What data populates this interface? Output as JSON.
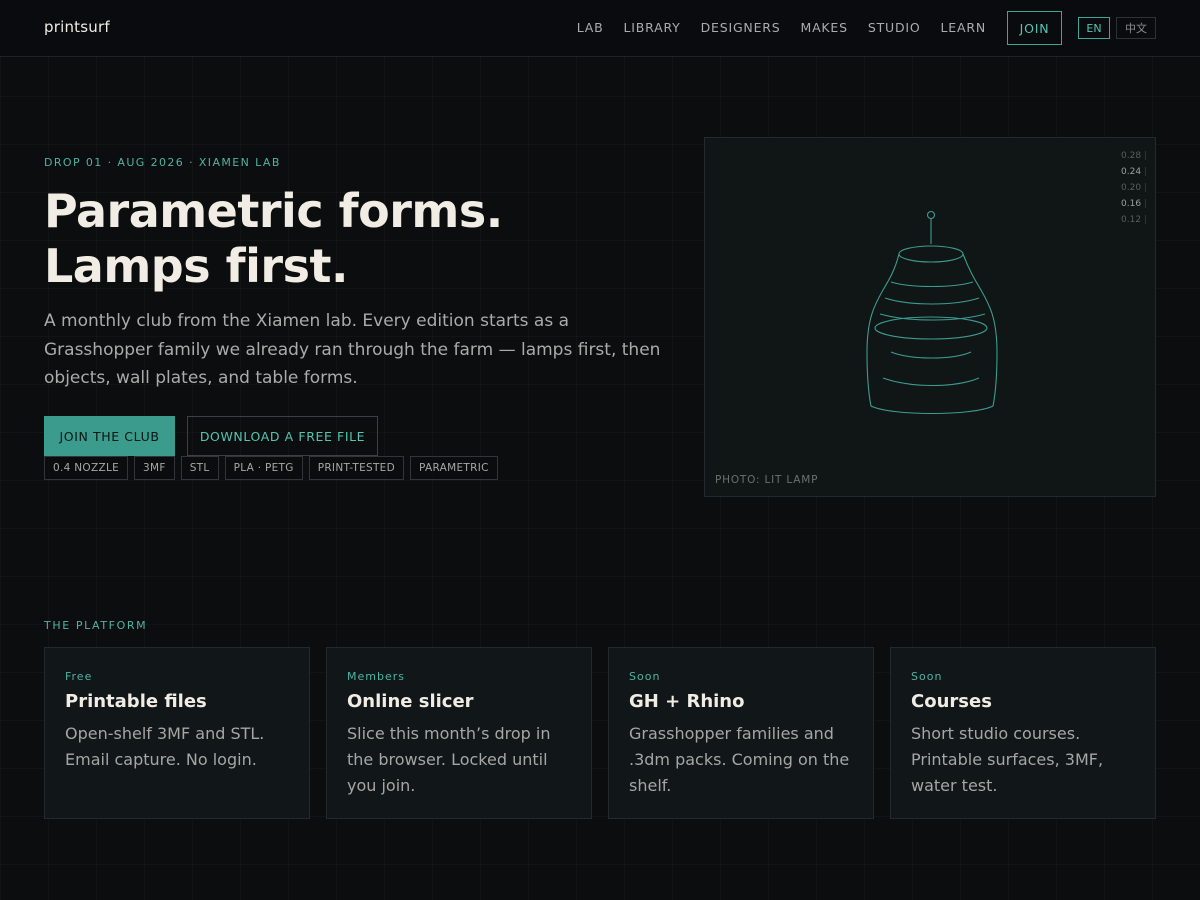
{
  "nav": {
    "logo": "printsurf",
    "links": [
      "LAB",
      "LIBRARY",
      "DESIGNERS",
      "MAKES",
      "STUDIO",
      "LEARN"
    ],
    "join": "JOIN",
    "lang_en": "EN",
    "lang_zh": "中文"
  },
  "hero": {
    "eyebrow": "DROP 01 · AUG 2026 · XIAMEN LAB",
    "title": "Parametric forms. Lamps first.",
    "description": "A monthly club from the Xiamen lab. Every edition starts as a Grasshopper family we already ran through the farm — lamps first, then objects, wall plates, and table forms.",
    "primary_cta": "JOIN THE CLUB",
    "secondary_cta": "DOWNLOAD A FREE FILE",
    "chips": [
      "0.4 NOZZLE",
      "3MF",
      "STL",
      "PLA · PETG",
      "PRINT-TESTED",
      "PARAMETRIC"
    ]
  },
  "photo": {
    "caption": "PHOTO: LIT LAMP",
    "scale": [
      "0.28",
      "0.24",
      "0.20",
      "0.16",
      "0.12"
    ],
    "accent_color": "#3fa596"
  },
  "platform": {
    "label": "THE PLATFORM",
    "cards": [
      {
        "tag": "Free",
        "title": "Printable files",
        "desc": "Open-shelf 3MF and STL. Email capture. No login."
      },
      {
        "tag": "Members",
        "title": "Online slicer",
        "desc": "Slice this month’s drop in the browser. Locked until you join."
      },
      {
        "tag": "Soon",
        "title": "GH + Rhino",
        "desc": "Grasshopper families and .3dm packs. Coming on the shelf."
      },
      {
        "tag": "Soon",
        "title": "Courses",
        "desc": "Short studio courses. Printable surfaces, 3MF, water test."
      }
    ]
  },
  "colors": {
    "accent": "#3fa596",
    "background": "#0b0d0f",
    "text": "#f1ede5"
  }
}
